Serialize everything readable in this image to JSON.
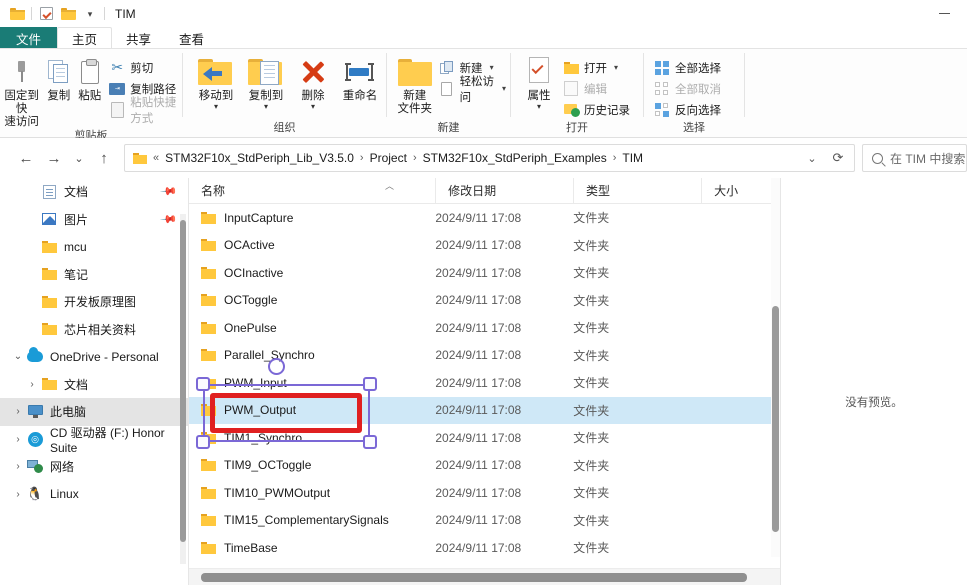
{
  "window": {
    "title": "TIM",
    "minimize_label": "—",
    "quick_access": [
      "folder-icon",
      "properties-check-icon",
      "new-folder-icon",
      "customize-caret-icon"
    ]
  },
  "ribbon": {
    "tabs": [
      {
        "label": "文件",
        "type": "file"
      },
      {
        "label": "主页",
        "type": "active"
      },
      {
        "label": "共享",
        "type": "normal"
      },
      {
        "label": "查看",
        "type": "normal"
      }
    ],
    "groups": [
      {
        "name": "剪贴板",
        "big_buttons": [
          {
            "label": "固定到快\n速访问",
            "icon": "pin-icon"
          },
          {
            "label": "复制",
            "icon": "copy-icon"
          },
          {
            "label": "粘贴",
            "icon": "paste-icon"
          }
        ],
        "small_buttons": [
          {
            "label": "剪切",
            "icon": "scissors-icon",
            "disabled": false
          },
          {
            "label": "复制路径",
            "icon": "copy-path-icon",
            "disabled": false
          },
          {
            "label": "粘贴快捷方式",
            "icon": "paste-shortcut-icon",
            "disabled": true
          }
        ]
      },
      {
        "name": "组织",
        "big_buttons": [
          {
            "label": "移动到",
            "icon": "move-to-icon",
            "dropdown": true
          },
          {
            "label": "复制到",
            "icon": "copy-to-icon",
            "dropdown": true
          },
          {
            "label": "删除",
            "icon": "delete-x-icon",
            "dropdown": true
          },
          {
            "label": "重命名",
            "icon": "rename-icon"
          }
        ]
      },
      {
        "name": "新建",
        "big_buttons": [
          {
            "label": "新建\n文件夹",
            "icon": "new-folder-icon"
          }
        ],
        "small_buttons": [
          {
            "label": "新建",
            "icon": "new-item-icon",
            "caret": true
          },
          {
            "label": "轻松访问",
            "icon": "easy-access-icon",
            "caret": true
          }
        ]
      },
      {
        "name": "打开",
        "big_buttons": [
          {
            "label": "属性",
            "icon": "properties-icon",
            "dropdown": true
          }
        ],
        "small_buttons": [
          {
            "label": "打开",
            "icon": "open-folder-icon",
            "caret": true
          },
          {
            "label": "编辑",
            "icon": "edit-icon",
            "disabled": true
          },
          {
            "label": "历史记录",
            "icon": "history-icon"
          }
        ]
      },
      {
        "name": "选择",
        "small_buttons": [
          {
            "label": "全部选择",
            "icon": "select-all-icon"
          },
          {
            "label": "全部取消",
            "icon": "select-none-icon",
            "disabled": true
          },
          {
            "label": "反向选择",
            "icon": "invert-selection-icon"
          }
        ]
      }
    ]
  },
  "address": {
    "back_icon": "arrow-left-icon",
    "forward_icon": "arrow-right-icon",
    "recent_icon": "chevron-down-icon",
    "up_icon": "arrow-up-icon",
    "root_prefix": "«",
    "breadcrumbs": [
      "STM32F10x_StdPeriph_Lib_V3.5.0",
      "Project",
      "STM32F10x_StdPeriph_Examples",
      "TIM"
    ],
    "dropdown_icon": "chevron-down-icon",
    "refresh_icon": "refresh-icon",
    "search_placeholder": "在 TIM 中搜索"
  },
  "sidebar": {
    "items": [
      {
        "label": "文档",
        "icon": "documents-icon",
        "chevron": "",
        "pinned": true,
        "indent": 1,
        "selected": false
      },
      {
        "label": "图片",
        "icon": "pictures-icon",
        "chevron": "",
        "pinned": true,
        "indent": 1,
        "selected": false
      },
      {
        "label": "mcu",
        "icon": "folder-icon",
        "chevron": "",
        "pinned": false,
        "indent": 1,
        "selected": false
      },
      {
        "label": "笔记",
        "icon": "folder-icon",
        "chevron": "",
        "pinned": false,
        "indent": 1,
        "selected": false
      },
      {
        "label": "开发板原理图",
        "icon": "folder-icon",
        "chevron": "",
        "pinned": false,
        "indent": 1,
        "selected": false
      },
      {
        "label": "芯片相关资料",
        "icon": "folder-icon",
        "chevron": "",
        "pinned": false,
        "indent": 1,
        "selected": false
      },
      {
        "label": "OneDrive - Personal",
        "icon": "onedrive-cloud-icon",
        "chevron": "⌄",
        "pinned": false,
        "indent": 0,
        "selected": false
      },
      {
        "label": "文档",
        "icon": "folder-icon",
        "chevron": "›",
        "pinned": false,
        "indent": 1,
        "selected": false
      },
      {
        "label": "此电脑",
        "icon": "this-pc-icon",
        "chevron": "›",
        "pinned": false,
        "indent": 0,
        "selected": true
      },
      {
        "label": "CD 驱动器 (F:) Honor Suite",
        "icon": "cd-drive-icon",
        "chevron": "›",
        "pinned": false,
        "indent": 0,
        "selected": false
      },
      {
        "label": "网络",
        "icon": "network-icon",
        "chevron": "›",
        "pinned": false,
        "indent": 0,
        "selected": false
      },
      {
        "label": "Linux",
        "icon": "linux-icon",
        "chevron": "›",
        "pinned": false,
        "indent": 0,
        "selected": false
      }
    ]
  },
  "filelist": {
    "columns": [
      "名称",
      "修改日期",
      "类型",
      "大小"
    ],
    "sort_column": "名称",
    "sort_direction": "asc",
    "rows": [
      {
        "name": "InputCapture",
        "date": "2024/9/11 17:08",
        "type": "文件夹",
        "size": "",
        "selected": false
      },
      {
        "name": "OCActive",
        "date": "2024/9/11 17:08",
        "type": "文件夹",
        "size": "",
        "selected": false
      },
      {
        "name": "OCInactive",
        "date": "2024/9/11 17:08",
        "type": "文件夹",
        "size": "",
        "selected": false
      },
      {
        "name": "OCToggle",
        "date": "2024/9/11 17:08",
        "type": "文件夹",
        "size": "",
        "selected": false
      },
      {
        "name": "OnePulse",
        "date": "2024/9/11 17:08",
        "type": "文件夹",
        "size": "",
        "selected": false
      },
      {
        "name": "Parallel_Synchro",
        "date": "2024/9/11 17:08",
        "type": "文件夹",
        "size": "",
        "selected": false
      },
      {
        "name": "PWM_Input",
        "date": "2024/9/11 17:08",
        "type": "文件夹",
        "size": "",
        "selected": false
      },
      {
        "name": "PWM_Output",
        "date": "2024/9/11 17:08",
        "type": "文件夹",
        "size": "",
        "selected": true
      },
      {
        "name": "TIM1_Synchro",
        "date": "2024/9/11 17:08",
        "type": "文件夹",
        "size": "",
        "selected": false
      },
      {
        "name": "TIM9_OCToggle",
        "date": "2024/9/11 17:08",
        "type": "文件夹",
        "size": "",
        "selected": false
      },
      {
        "name": "TIM10_PWMOutput",
        "date": "2024/9/11 17:08",
        "type": "文件夹",
        "size": "",
        "selected": false
      },
      {
        "name": "TIM15_ComplementarySignals",
        "date": "2024/9/11 17:08",
        "type": "文件夹",
        "size": "",
        "selected": false
      },
      {
        "name": "TimeBase",
        "date": "2024/9/11 17:08",
        "type": "文件夹",
        "size": "",
        "selected": false
      }
    ]
  },
  "preview": {
    "message": "没有预览。"
  },
  "annotation": {
    "target_item": "PWM_Output",
    "highlight_color": "#e02020",
    "selection_color": "#7b68d6"
  }
}
